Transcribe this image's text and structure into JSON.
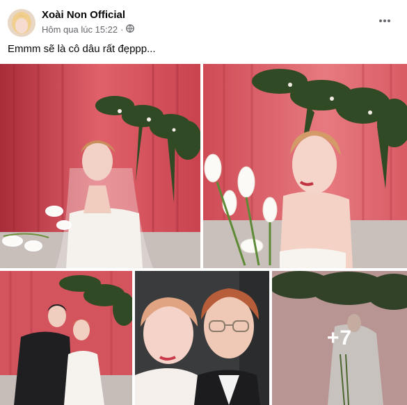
{
  "post": {
    "author": "Xoài Non Official",
    "timestamp": "Hôm qua lúc 15:22",
    "separator": "·",
    "privacy_icon": "globe-icon",
    "more_icon": "more-horizontal-icon",
    "caption": "Emmm sẽ là cô dâu rất đẹppp..."
  },
  "gallery": {
    "more_count": "+7"
  },
  "colors": {
    "curtain": "#d6515b",
    "curtain_dark": "#a82c39",
    "floor": "#c9c1bd",
    "greenery": "#2f4a24",
    "dress": "#f5f2ee",
    "text_secondary": "#65676b"
  }
}
